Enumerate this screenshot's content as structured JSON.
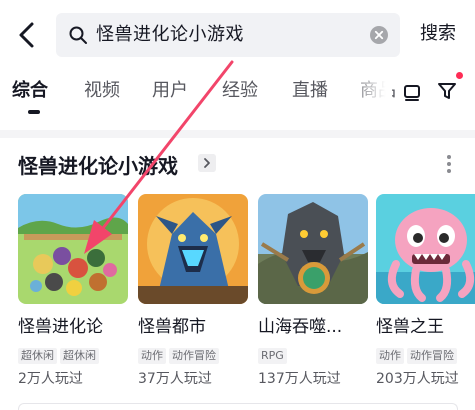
{
  "search": {
    "query": "怪兽进化论小游戏",
    "button_label": "搜索"
  },
  "tabs": [
    {
      "label": "综合",
      "active": true
    },
    {
      "label": "视频",
      "active": false
    },
    {
      "label": "用户",
      "active": false
    },
    {
      "label": "经验",
      "active": false
    },
    {
      "label": "直播",
      "active": false
    },
    {
      "label": "商品",
      "active": false
    }
  ],
  "section": {
    "title": "怪兽进化论小游戏",
    "chevron": "chevron-right-icon",
    "more": "more-vertical-icon"
  },
  "games": [
    {
      "name": "怪兽进化论",
      "tags": [
        "超休闲",
        "超休闲"
      ],
      "plays": "2万人玩过"
    },
    {
      "name": "怪兽都市",
      "tags": [
        "动作",
        "动作冒险"
      ],
      "plays": "37万人玩过"
    },
    {
      "name": "山海吞噬...",
      "tags": [
        "RPG"
      ],
      "plays": "137万人玩过"
    },
    {
      "name": "怪兽之王",
      "tags": [
        "动作",
        "动作冒险"
      ],
      "plays": "203万人玩过"
    }
  ],
  "colors": {
    "annotation_arrow": "#f2456a",
    "notification_dot": "#fe2c55",
    "text_primary": "#161823",
    "text_secondary": "#57585f"
  }
}
